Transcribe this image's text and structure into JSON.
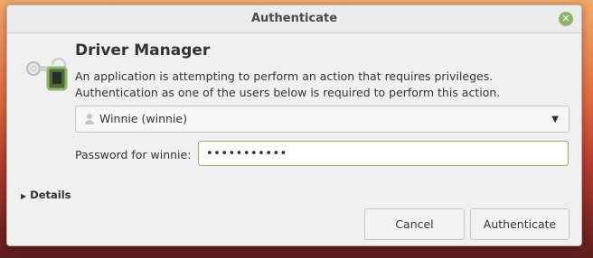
{
  "window": {
    "title": "Authenticate",
    "close_icon": "close-icon"
  },
  "app": {
    "title": "Driver Manager",
    "icon": "lock-icon",
    "message": "An application is attempting to perform an action that requires privileges. Authentication as one of the users below is required to perform this action."
  },
  "user_select": {
    "icon": "user-icon",
    "selected": "Winnie (winnie)"
  },
  "password": {
    "label": "Password for winnie:",
    "value": "abcdefghijk"
  },
  "details": {
    "label": "Details"
  },
  "buttons": {
    "cancel": "Cancel",
    "authenticate": "Authenticate"
  },
  "colors": {
    "accent": "#8fb567",
    "dialog_bg": "#f0f0f0"
  }
}
